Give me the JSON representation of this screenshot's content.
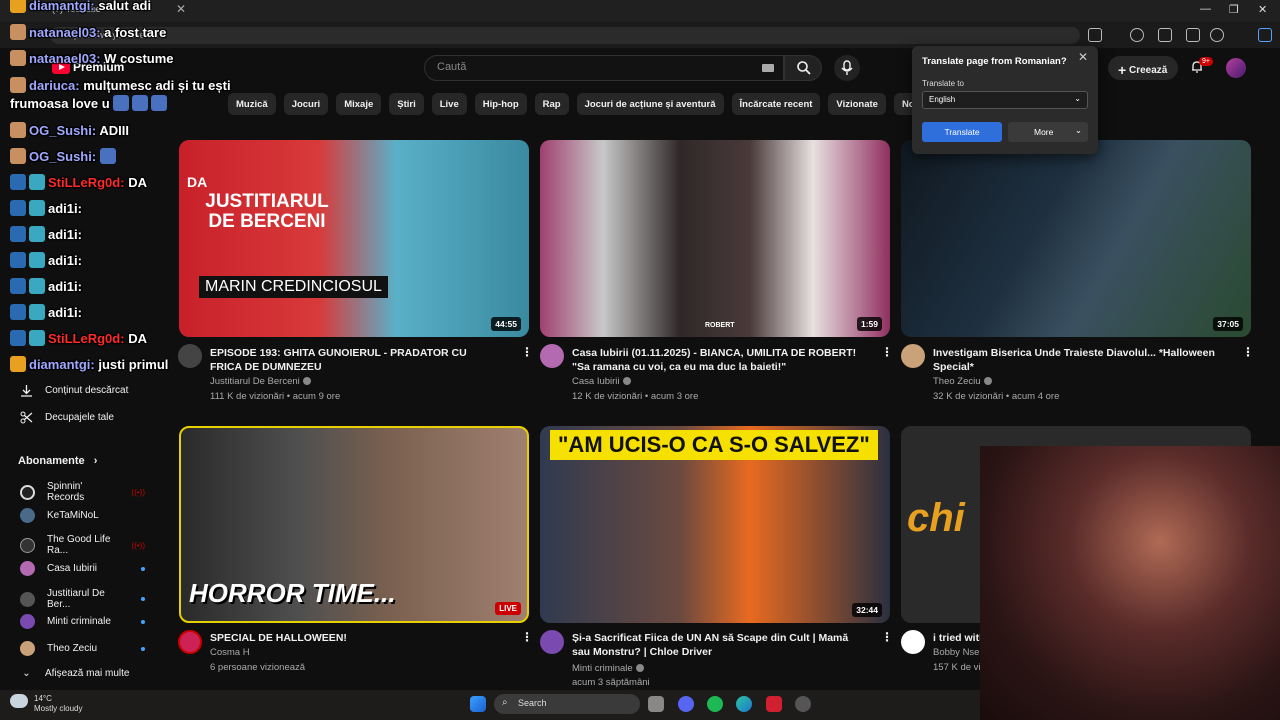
{
  "browser": {
    "tab_title": "(7) YouTube",
    "url": "https://www.youtube.com",
    "close_glyph": "✕",
    "win_min": "—",
    "win_max": "❐",
    "win_close": "✕"
  },
  "youtube": {
    "logo_text": "Premium",
    "search_placeholder": "Caută",
    "create_label": "Creează",
    "notif_count": "9+"
  },
  "chips": [
    "Muzică",
    "Jocuri",
    "Mixaje",
    "Știri",
    "Live",
    "Hip-hop",
    "Rap",
    "Jocuri de acțiune și aventură",
    "Încărcate recent",
    "Vizionate",
    "Noi pentru"
  ],
  "sidebar": {
    "downloads_label": "Conținut descărcat",
    "clips_label": "Decupajele tale",
    "subs_title": "Abonamente",
    "subs": [
      {
        "name": "Spinnin' Records"
      },
      {
        "name": "KeTaMiNoL"
      },
      {
        "name": "The Good Life Ra..."
      },
      {
        "name": "Casa Iubirii"
      },
      {
        "name": "Justitiarul De Ber..."
      },
      {
        "name": "Minti criminale"
      },
      {
        "name": "Theo Zeciu"
      }
    ],
    "show_more": "Afișează mai multe"
  },
  "videos": [
    {
      "title": "EPISODE 193: GHITA GUNOIERUL - PRADATOR CU FRICA DE DUMNEZEU",
      "channel": "Justitiarul De Berceni",
      "meta": "111 K de vizionări • acum 9 ore",
      "duration": "44:55",
      "thumb_top": "DA",
      "thumb_brand": "JUSTITIARUL DE BERCENI",
      "thumb_caption": "MARIN CREDINCIOSUL"
    },
    {
      "title": "Casa Iubirii (01.11.2025) - BIANCA, UMILITA DE ROBERT! \"Sa ramana cu voi, ca eu ma duc la baieti!\"",
      "channel": "Casa Iubirii",
      "meta": "12 K de vizionări • acum 3 ore",
      "duration": "1:59",
      "thumb_label": "ROBERT"
    },
    {
      "title": "Investigam Biserica Unde Traieste Diavolul... *Halloween Special*",
      "channel": "Theo Zeciu",
      "meta": "32 K de vizionări • acum 4 ore",
      "duration": "37:05"
    },
    {
      "title": "SPECIAL DE HALLOWEEN!",
      "channel": "Cosma H",
      "meta": "6 persoane vizionează",
      "live": "LIVE",
      "thumb_caption": "HORROR TIME..."
    },
    {
      "title": "Și-a Sacrificat Fiica de UN AN să Scape din Cult | Mamă sau Monstru? | Chloe Driver",
      "channel": "Minti criminale",
      "meta": "acum 3 săptămâni",
      "duration": "32:44",
      "thumb_caption": "\"AM UCIS-O CA S-O SALVEZ\""
    },
    {
      "title": "i tried with",
      "channel": "Bobby Nser",
      "meta": "157 K de vi",
      "thumb_caption": "chi"
    }
  ],
  "translate_popup": {
    "title": "Translate page from Romanian?",
    "to_label": "Translate to",
    "language": "English",
    "translate_btn": "Translate",
    "more_btn": "More"
  },
  "chat": [
    {
      "user": "diamantgi:",
      "msg": "salut adi"
    },
    {
      "user": "natanael03:",
      "msg": "a fost tare"
    },
    {
      "user": "natanael03:",
      "msg": "W costume"
    },
    {
      "user": "dariuca:",
      "msg": "mulțumesc adi și tu ești"
    },
    {
      "user": "",
      "msg": "frumoasa love u"
    },
    {
      "user": "OG_Sushi:",
      "msg": "ADIII"
    },
    {
      "user": "OG_Sushi:",
      "msg": ""
    },
    {
      "user": "StiLLeRg0d:",
      "msg": "DA"
    },
    {
      "user": "adi1i:",
      "msg": ""
    },
    {
      "user": "adi1i:",
      "msg": ""
    },
    {
      "user": "adi1i:",
      "msg": ""
    },
    {
      "user": "adi1i:",
      "msg": ""
    },
    {
      "user": "adi1i:",
      "msg": ""
    },
    {
      "user": "StiLLeRg0d:",
      "msg": "DA"
    },
    {
      "user": "diamantgi:",
      "msg": "justi primul"
    }
  ],
  "taskbar": {
    "temp": "14°C",
    "weather": "Mostly cloudy",
    "search": "Search"
  },
  "colors": {
    "yt_red": "#ff0033",
    "chat_user": "#9fa8ff",
    "chat_user_red": "#ff2a2a",
    "translate_blue": "#2f6fdc",
    "link_blue": "#3ea6ff"
  }
}
